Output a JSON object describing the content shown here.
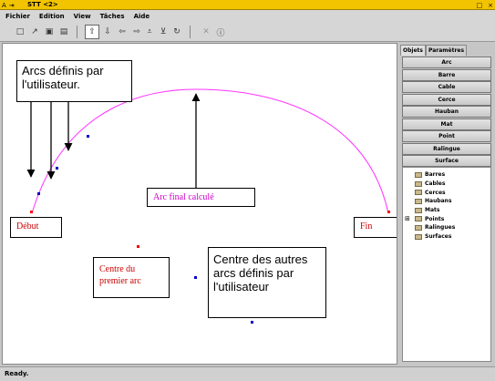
{
  "window": {
    "title": "STT <2>",
    "left_icons": [
      "A",
      "⇥"
    ],
    "controls": [
      "□",
      "×"
    ]
  },
  "menu": [
    "Fichier",
    "Edition",
    "View",
    "Tâches",
    "Aide"
  ],
  "toolbar": {
    "icons": [
      "new-file-icon",
      "open-file-icon",
      "save-icon",
      "save-as-icon",
      "arrow-up-icon",
      "arrow-down-icon",
      "arrow-left-icon",
      "arrow-right-icon",
      "align-bottom-icon",
      "filter-icon",
      "refresh-icon",
      "cancel-icon",
      "info-icon"
    ],
    "glyphs": [
      "□",
      "↗",
      "▣",
      "▤",
      "⇧",
      "⇩",
      "⇦",
      "⇨",
      "⩡",
      "⊻",
      "↻",
      "✕",
      "ⓘ"
    ]
  },
  "canvas": {
    "labels": {
      "arcs_user": "Arcs définis par l'utilisateur.",
      "arc_final": "Arc final calculé",
      "debut": "Début",
      "fin": "Fin",
      "centre_premier": "Centre du premier arc",
      "centre_autres": "Centre des autres arcs définis par l'utilisateur"
    },
    "colors": {
      "arc": "#ff33ff",
      "arc_final_text": "#cc00cc",
      "red_text": "#cc0000",
      "red_point": "#ff0000",
      "blue_point": "#0000cc"
    }
  },
  "panel": {
    "tabs": [
      "Objets",
      "Paramètres"
    ],
    "buttons": [
      "Arc",
      "Barre",
      "Cable",
      "Cerce",
      "Hauban",
      "Mat",
      "Point",
      "Ralingue",
      "Surface"
    ],
    "tree_expander": "⊞",
    "tree": [
      "Barres",
      "Cables",
      "Cerces",
      "Haubans",
      "Mats",
      "Points",
      "Ralingues",
      "Surfaces"
    ]
  },
  "status": "Ready."
}
